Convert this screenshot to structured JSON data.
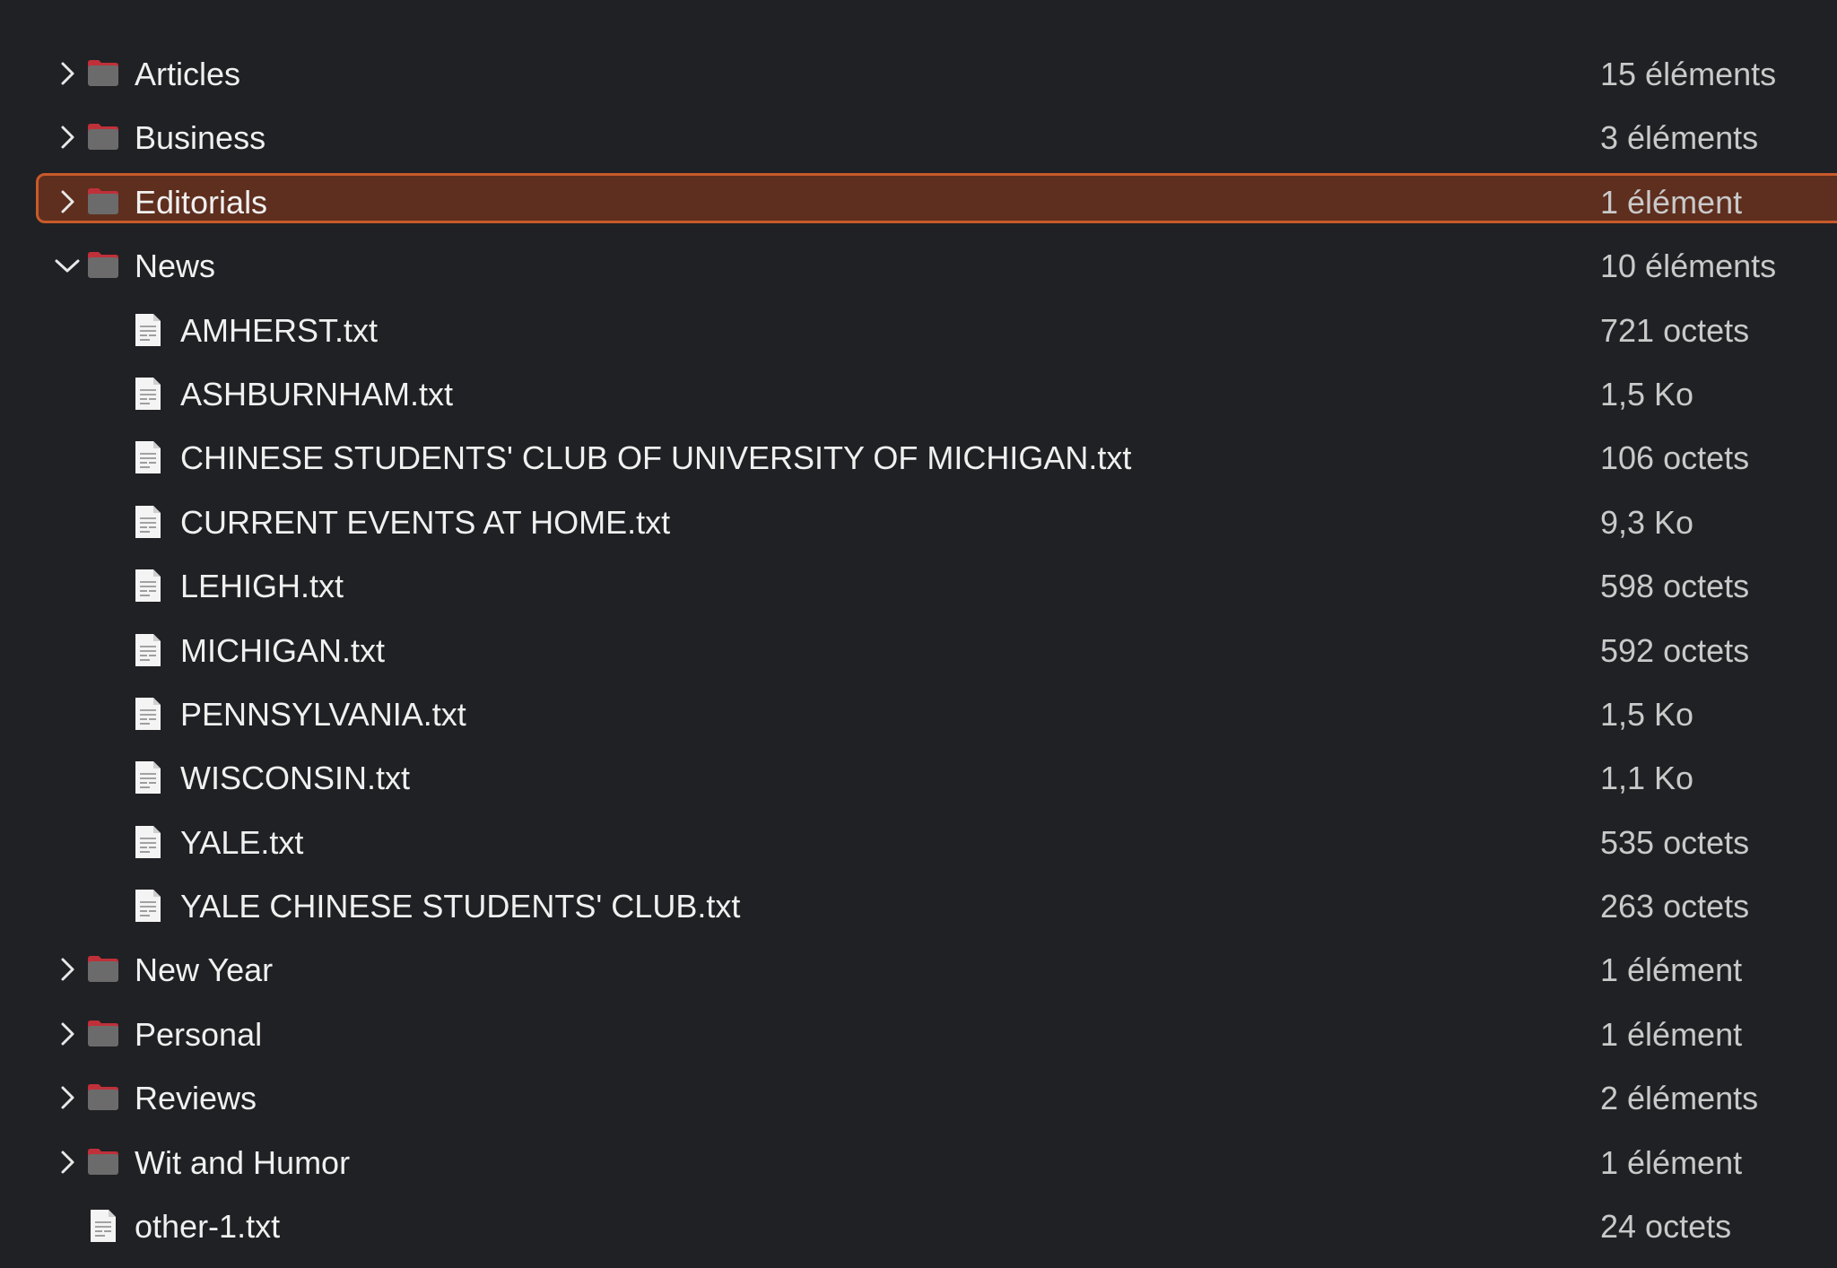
{
  "entries": [
    {
      "name": "Articles",
      "size": "15 éléments",
      "kind": "folder",
      "expander": "chevron-right"
    },
    {
      "name": "Business",
      "size": "3 éléments",
      "kind": "folder",
      "expander": "chevron-right"
    },
    {
      "name": "Editorials",
      "size": "1 élément",
      "kind": "folder",
      "expander": "chevron-right",
      "selected": true
    },
    {
      "name": "News",
      "size": "10 éléments",
      "kind": "folder",
      "expander": "chevron-down"
    },
    {
      "name": "AMHERST.txt",
      "size": "721 octets",
      "kind": "file"
    },
    {
      "name": "ASHBURNHAM.txt",
      "size": "1,5 Ko",
      "kind": "file"
    },
    {
      "name": "CHINESE STUDENTS' CLUB OF UNIVERSITY OF MICHIGAN.txt",
      "size": "106 octets",
      "kind": "file"
    },
    {
      "name": "CURRENT EVENTS AT HOME.txt",
      "size": "9,3 Ko",
      "kind": "file"
    },
    {
      "name": "LEHIGH.txt",
      "size": "598 octets",
      "kind": "file"
    },
    {
      "name": "MICHIGAN.txt",
      "size": "592 octets",
      "kind": "file"
    },
    {
      "name": "PENNSYLVANIA.txt",
      "size": "1,5 Ko",
      "kind": "file"
    },
    {
      "name": "WISCONSIN.txt",
      "size": "1,1 Ko",
      "kind": "file"
    },
    {
      "name": "YALE.txt",
      "size": "535 octets",
      "kind": "file"
    },
    {
      "name": "YALE CHINESE STUDENTS' CLUB.txt",
      "size": "263 octets",
      "kind": "file"
    },
    {
      "name": "New Year",
      "size": "1 élément",
      "kind": "folder",
      "expander": "chevron-right"
    },
    {
      "name": "Personal",
      "size": "1 élément",
      "kind": "folder",
      "expander": "chevron-right"
    },
    {
      "name": "Reviews",
      "size": "2 éléments",
      "kind": "folder",
      "expander": "chevron-right"
    },
    {
      "name": "Wit and Humor",
      "size": "1 élément",
      "kind": "folder",
      "expander": "chevron-right"
    },
    {
      "name": "other-1.txt",
      "size": "24 octets",
      "kind": "file"
    }
  ],
  "colors": {
    "background": "#202124",
    "selection_fill": "#5e2e1e",
    "selection_border": "#c85a2a",
    "folder_body": "#6b6b6b",
    "folder_tab": "#c0303a"
  }
}
